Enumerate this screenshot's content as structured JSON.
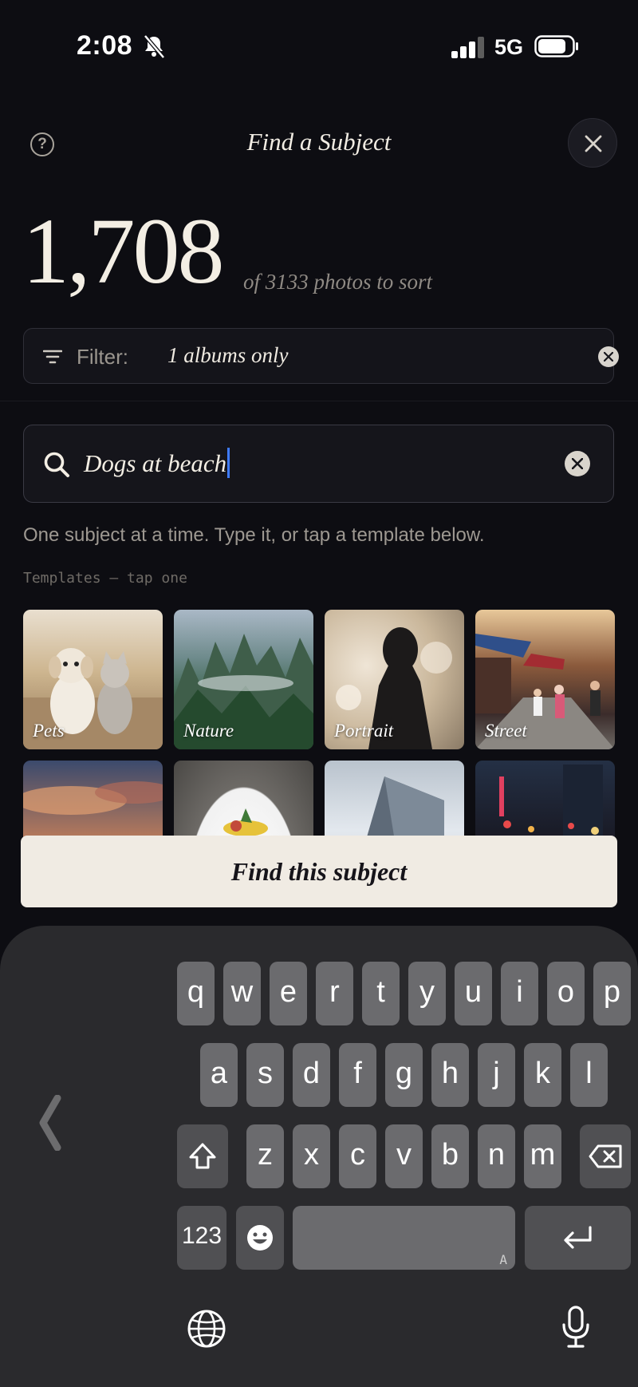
{
  "status_bar": {
    "time": "2:08",
    "network": "5G"
  },
  "header": {
    "title": "Find a Subject",
    "help_glyph": "?"
  },
  "count": {
    "value": "1,708",
    "subtitle": "of 3133  photos to sort"
  },
  "filter": {
    "label": "Filter:",
    "value": "1 albums only"
  },
  "search": {
    "value": "Dogs at beach"
  },
  "hint": "One subject at a time. Type it, or tap a template below.",
  "templates_label": "Templates — tap one",
  "templates": [
    {
      "label": "Pets"
    },
    {
      "label": "Nature"
    },
    {
      "label": "Portrait"
    },
    {
      "label": "Street"
    }
  ],
  "cta_label": "Find this subject",
  "keyboard": {
    "row1": [
      "q",
      "w",
      "e",
      "r",
      "t",
      "y",
      "u",
      "i",
      "o",
      "p"
    ],
    "row2": [
      "a",
      "s",
      "d",
      "f",
      "g",
      "h",
      "j",
      "k",
      "l"
    ],
    "row3": [
      "z",
      "x",
      "c",
      "v",
      "b",
      "n",
      "m"
    ],
    "numbers_key": "123",
    "space_sub": "A"
  }
}
